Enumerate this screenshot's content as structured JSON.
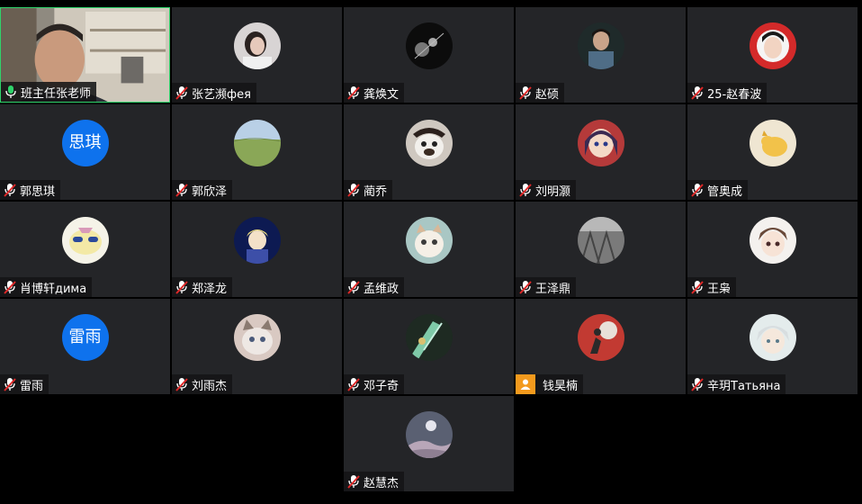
{
  "participants": [
    {
      "name": "班主任张老师",
      "mic": "on",
      "video": true
    },
    {
      "name": "张艺濒фея",
      "mic": "muted",
      "avatar": "photo"
    },
    {
      "name": "龚焕文",
      "mic": "muted",
      "avatar": "photo"
    },
    {
      "name": "赵硕",
      "mic": "muted",
      "avatar": "photo"
    },
    {
      "name": "25-赵春波",
      "mic": "muted",
      "avatar": "photo"
    },
    {
      "name": "郭思琪",
      "mic": "muted",
      "avatar_text": "思琪"
    },
    {
      "name": "郭欣泽",
      "mic": "muted",
      "avatar": "photo"
    },
    {
      "name": "蔺乔",
      "mic": "muted",
      "avatar": "photo"
    },
    {
      "name": "刘明灏",
      "mic": "muted",
      "avatar": "photo"
    },
    {
      "name": "管奥成",
      "mic": "muted",
      "avatar": "photo"
    },
    {
      "name": "肖博轩дима",
      "mic": "muted",
      "avatar": "photo"
    },
    {
      "name": "郑泽龙",
      "mic": "muted",
      "avatar": "photo"
    },
    {
      "name": "孟维政",
      "mic": "muted",
      "avatar": "photo"
    },
    {
      "name": "王泽鼎",
      "mic": "muted",
      "avatar": "photo"
    },
    {
      "name": "王枭",
      "mic": "muted",
      "avatar": "photo"
    },
    {
      "name": "雷雨",
      "mic": "muted",
      "avatar_text": "雷雨"
    },
    {
      "name": "刘雨杰",
      "mic": "muted",
      "avatar": "photo"
    },
    {
      "name": "邓子奇",
      "mic": "muted",
      "avatar": "photo"
    },
    {
      "name": "钱昊楠",
      "mic": "none",
      "badge": "person-icon",
      "avatar": "photo"
    },
    {
      "name": "辛玥Татьяна",
      "mic": "muted",
      "avatar": "photo"
    },
    {
      "name": "赵慧杰",
      "mic": "muted",
      "avatar": "photo"
    }
  ],
  "colors": {
    "tile": "#242528",
    "active_border": "#2fd36b",
    "letter_avatar": "#0e72ed",
    "badge": "#f39a1d",
    "mic_on": "#2fd36b",
    "mic_muted": "#e02828"
  }
}
